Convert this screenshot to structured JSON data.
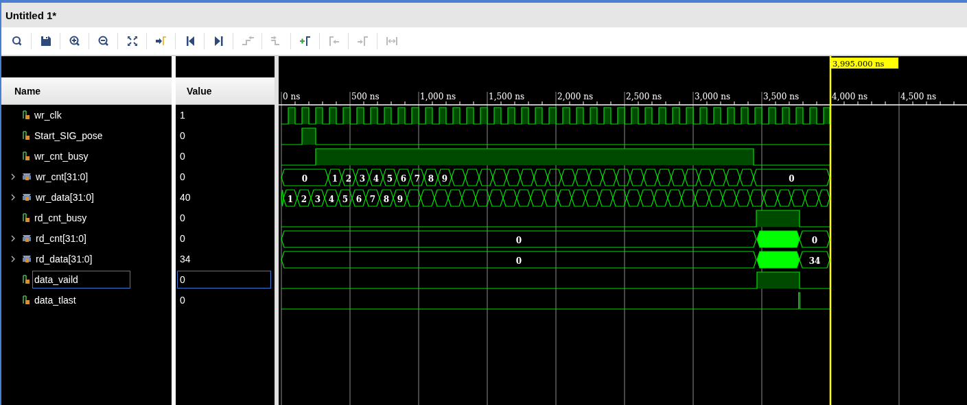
{
  "window": {
    "title": "Untitled 1*"
  },
  "toolbar": [
    {
      "kind": "search",
      "disabled": false
    },
    {
      "kind": "save",
      "disabled": false
    },
    {
      "kind": "zoom-in",
      "disabled": false
    },
    {
      "kind": "zoom-out",
      "disabled": false
    },
    {
      "kind": "zoom-fit",
      "disabled": false
    },
    {
      "kind": "go-to-cursor",
      "disabled": false
    },
    {
      "kind": "go-to-start",
      "disabled": false
    },
    {
      "kind": "go-to-end",
      "disabled": false
    },
    {
      "kind": "previous-transition",
      "disabled": true
    },
    {
      "kind": "next-transition",
      "disabled": true
    },
    {
      "kind": "add-marker",
      "disabled": false
    },
    {
      "kind": "previous-marker",
      "disabled": true
    },
    {
      "kind": "next-marker",
      "disabled": true
    },
    {
      "kind": "swap-cursors",
      "disabled": true
    }
  ],
  "columns": {
    "name": "Name",
    "value": "Value"
  },
  "timeline": {
    "ticks": [
      "0 ns",
      "500 ns",
      "1,000 ns",
      "1,500 ns",
      "2,000 ns",
      "2,500 ns",
      "3,000 ns",
      "3,500 ns",
      "4,000 ns",
      "4,500 ns"
    ],
    "cursor": "3,995.000 ns"
  },
  "signals": [
    {
      "name": "wr_clk",
      "value": "1",
      "kind": "bit",
      "selected": false
    },
    {
      "name": "Start_SIG_pose",
      "value": "0",
      "kind": "bit",
      "selected": false
    },
    {
      "name": "wr_cnt_busy",
      "value": "0",
      "kind": "bit",
      "selected": false
    },
    {
      "name": "wr_cnt[31:0]",
      "value": "0",
      "kind": "bus",
      "expanded": false,
      "selected": false,
      "wave_labels": [
        "0",
        "1",
        "2",
        "3",
        "4",
        "5",
        "6",
        "7",
        "8",
        "9",
        "0"
      ]
    },
    {
      "name": "wr_data[31:0]",
      "value": "40",
      "kind": "bus",
      "expanded": false,
      "selected": false,
      "wave_labels": [
        "1",
        "2",
        "3",
        "4",
        "5",
        "6",
        "7",
        "8",
        "9"
      ]
    },
    {
      "name": "rd_cnt_busy",
      "value": "0",
      "kind": "bit",
      "selected": false
    },
    {
      "name": "rd_cnt[31:0]",
      "value": "0",
      "kind": "bus",
      "expanded": false,
      "selected": false,
      "wave_labels": [
        "0",
        "0"
      ]
    },
    {
      "name": "rd_data[31:0]",
      "value": "34",
      "kind": "bus",
      "expanded": false,
      "selected": false,
      "wave_labels": [
        "0",
        "34"
      ]
    },
    {
      "name": "data_vaild",
      "value": "0",
      "kind": "bit",
      "selected": true
    },
    {
      "name": "data_tlast",
      "value": "0",
      "kind": "bit",
      "selected": false
    }
  ]
}
